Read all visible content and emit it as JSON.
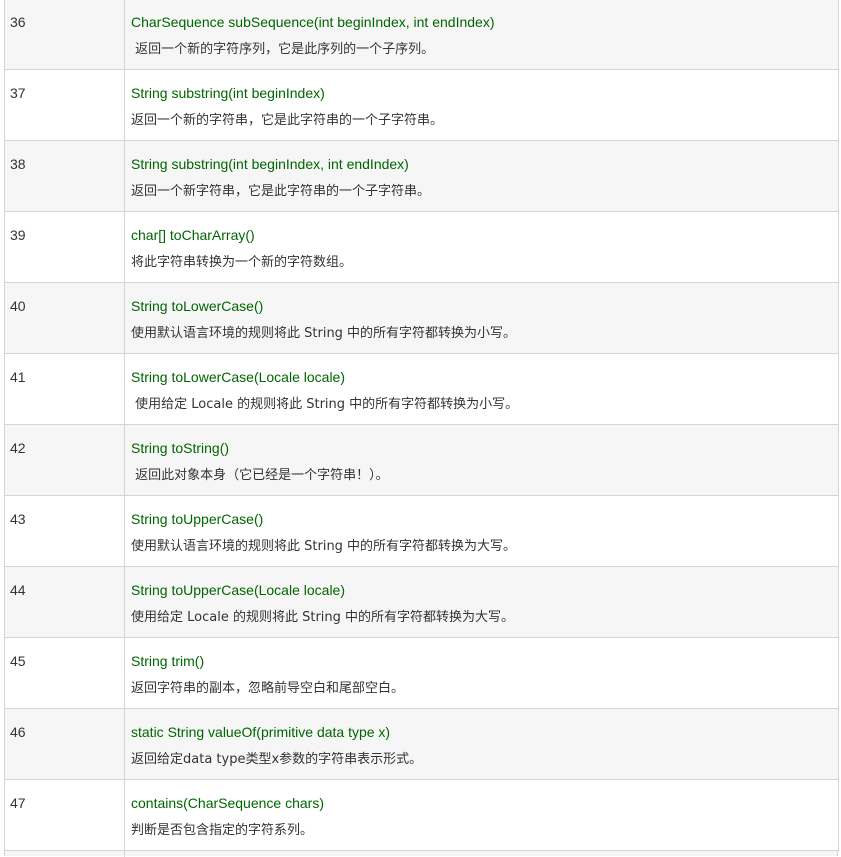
{
  "methods": [
    {
      "num": "36",
      "signature": "CharSequence subSequence(int beginIndex, int endIndex)",
      "description": " 返回一个新的字符序列，它是此序列的一个子序列。"
    },
    {
      "num": "37",
      "signature": "String substring(int beginIndex)",
      "description": "返回一个新的字符串，它是此字符串的一个子字符串。"
    },
    {
      "num": "38",
      "signature": "String substring(int beginIndex, int endIndex)",
      "description": "返回一个新字符串，它是此字符串的一个子字符串。"
    },
    {
      "num": "39",
      "signature": "char[] toCharArray()",
      "description": "将此字符串转换为一个新的字符数组。"
    },
    {
      "num": "40",
      "signature": "String toLowerCase()",
      "description": "使用默认语言环境的规则将此 String 中的所有字符都转换为小写。"
    },
    {
      "num": "41",
      "signature": "String toLowerCase(Locale locale)",
      "description": " 使用给定 Locale 的规则将此 String 中的所有字符都转换为小写。"
    },
    {
      "num": "42",
      "signature": "String toString()",
      "description": " 返回此对象本身（它已经是一个字符串！）。"
    },
    {
      "num": "43",
      "signature": "String toUpperCase()",
      "description": "使用默认语言环境的规则将此 String 中的所有字符都转换为大写。"
    },
    {
      "num": "44",
      "signature": "String toUpperCase(Locale locale)",
      "description": "使用给定 Locale 的规则将此 String 中的所有字符都转换为大写。"
    },
    {
      "num": "45",
      "signature": "String trim()",
      "description": "返回字符串的副本，忽略前导空白和尾部空白。"
    },
    {
      "num": "46",
      "signature": "static String valueOf(primitive data type x)",
      "description": "返回给定data type类型x参数的字符串表示形式。"
    },
    {
      "num": "47",
      "signature": "contains(CharSequence chars)",
      "description": "判断是否包含指定的字符系列。"
    }
  ]
}
